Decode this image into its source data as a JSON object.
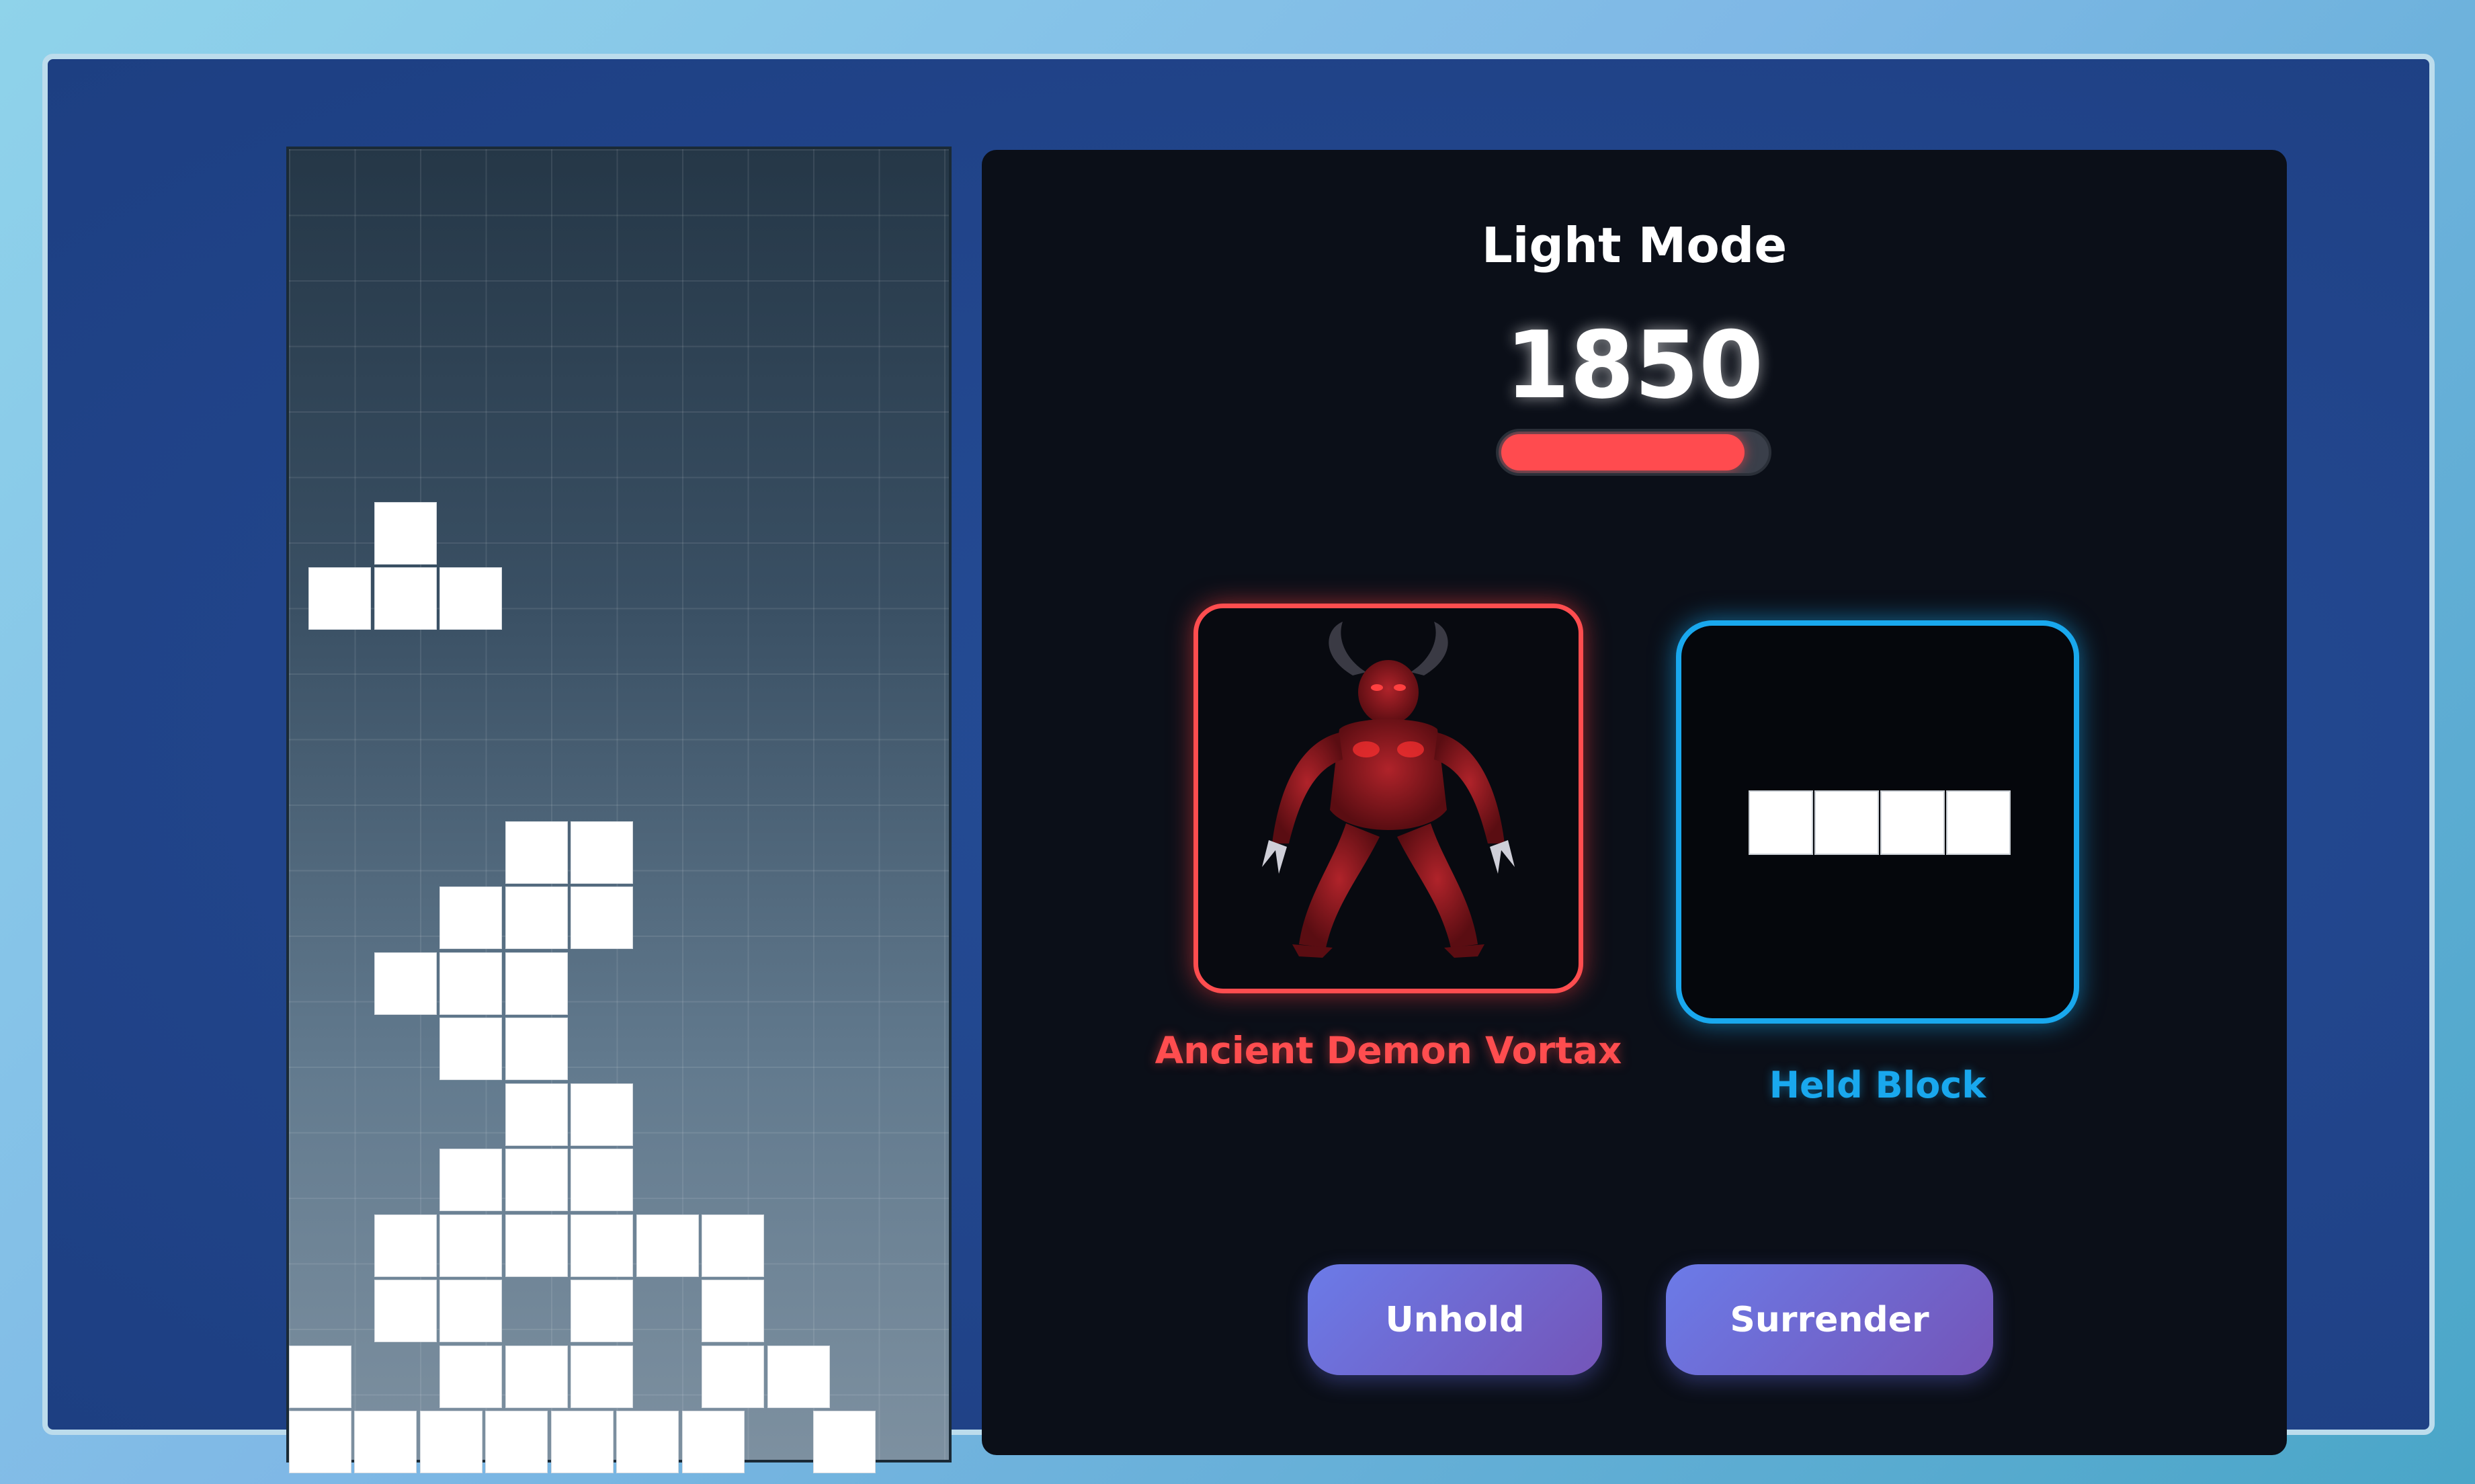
{
  "game": {
    "mode_title": "Light Mode",
    "score": "1850",
    "enemy_health_fraction": 0.92
  },
  "enemy": {
    "name": "Ancient Demon Vortax",
    "portrait": "demon-portrait"
  },
  "hold": {
    "label": "Held Block",
    "piece": "I-piece"
  },
  "buttons": {
    "unhold": "Unhold",
    "surrender": "Surrender"
  },
  "colors": {
    "enemy_accent": "#ff4d4f",
    "hold_accent": "#19a8ee",
    "button_gradient_start": "#6b7be8",
    "button_gradient_end": "#7455b8",
    "block": "#ffffff"
  },
  "board": {
    "columns": 10,
    "rows": 20,
    "active_piece": "T-piece",
    "filled_cells": [
      [
        3,
        5
      ],
      [
        4,
        4
      ],
      [
        4,
        3
      ],
      [
        4,
        2
      ],
      [
        3,
        1
      ],
      [
        3,
        2
      ],
      [
        4,
        1
      ],
      [
        5,
        2
      ],
      [
        5,
        3
      ],
      [
        4,
        4
      ],
      [
        5,
        6
      ],
      [
        4,
        6
      ],
      [
        5,
        6
      ],
      [
        6,
        6
      ],
      [
        7,
        6
      ],
      [
        8,
        6
      ],
      [
        6,
        9
      ],
      [
        7,
        9
      ],
      [
        7,
        8
      ],
      [
        6,
        8
      ],
      [
        5,
        8
      ],
      [
        5,
        7
      ]
    ]
  }
}
